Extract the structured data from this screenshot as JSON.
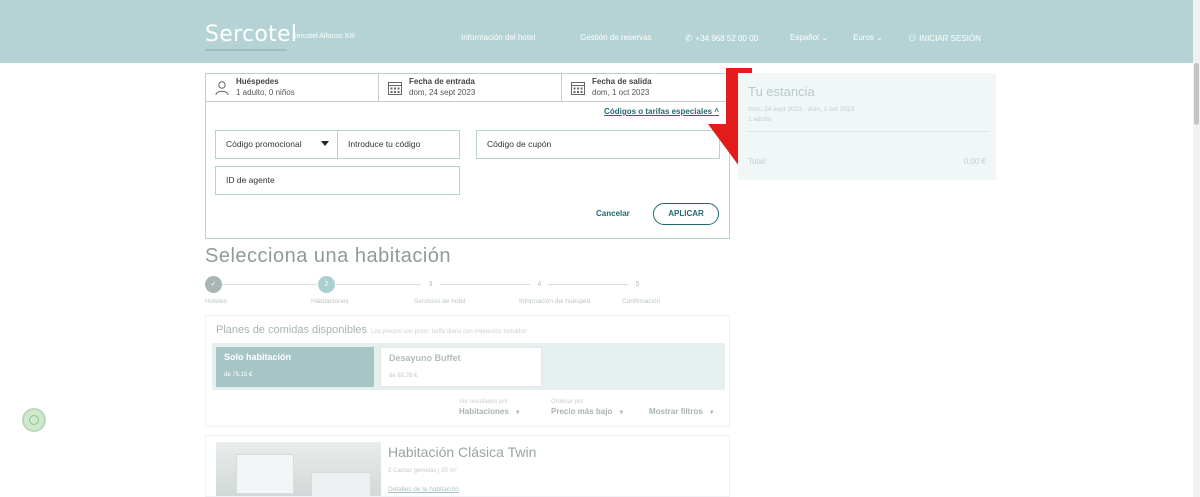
{
  "header": {
    "logo": "Sercotel",
    "hotel_name": "Sercotel Alfonso XIII",
    "nav": {
      "info": "Información del hotel",
      "reservations": "Gestión de reservas",
      "phone": "+34 968 52 00 00",
      "language": "Español",
      "currency": "Euros",
      "login": "INICIAR SESIÓN"
    },
    "background_color": "#b5d3d4"
  },
  "booking": {
    "guests_label": "Huéspedes",
    "guests_value": "1 adulto, 0 niños",
    "checkin_label": "Fecha de entrada",
    "checkin_value": "dom, 24 sept 2023",
    "checkout_label": "Fecha de salida",
    "checkout_value": "dom, 1 oct 2023",
    "codes_link": "Códigos o tarifas especiales",
    "promo_select": "Código promocional",
    "promo_input_placeholder": "Introduce tu código",
    "coupon_placeholder": "Código de cupón",
    "agent_placeholder": "ID de agente",
    "cancel": "Cancelar",
    "apply": "APLICAR"
  },
  "annotation": {
    "arrow_color": "#e31b1b"
  },
  "stay": {
    "title": "Tu estancia",
    "dates": "dom, 24 sept 2023 - dom, 1 oct 2023",
    "guests": "1 adulto",
    "total_label": "Total:",
    "total_value": "0,00 €"
  },
  "select_room": {
    "title": "Selecciona una habitación",
    "steps": [
      {
        "num": "",
        "label": "Hoteles",
        "state": "done"
      },
      {
        "num": "2",
        "label": "Habitaciones",
        "state": "active"
      },
      {
        "num": "3",
        "label": "Servicios de hotel",
        "state": "todo"
      },
      {
        "num": "4",
        "label": "Información del huésped",
        "state": "todo"
      },
      {
        "num": "5",
        "label": "Confirmación",
        "state": "todo"
      }
    ]
  },
  "meals": {
    "title": "Planes de comidas disponibles",
    "note": "Los precios son prom. tarifa diaria con impuestos incluidos",
    "options": [
      {
        "name": "Solo habitación",
        "price": "de 76,15 €"
      },
      {
        "name": "Desayuno Buffet",
        "price": "de 89,28 €"
      }
    ],
    "filters": {
      "view_label": "Ver resultados por",
      "view_value": "Habitaciones",
      "sort_label": "Ordenar por",
      "sort_value": "Precio más bajo",
      "show_filters": "Mostrar filtros"
    }
  },
  "room": {
    "name": "Habitación Clásica Twin",
    "meta": "2 Camas gemelas  |  25 m²",
    "details_link": "Detalles de la habitación"
  }
}
